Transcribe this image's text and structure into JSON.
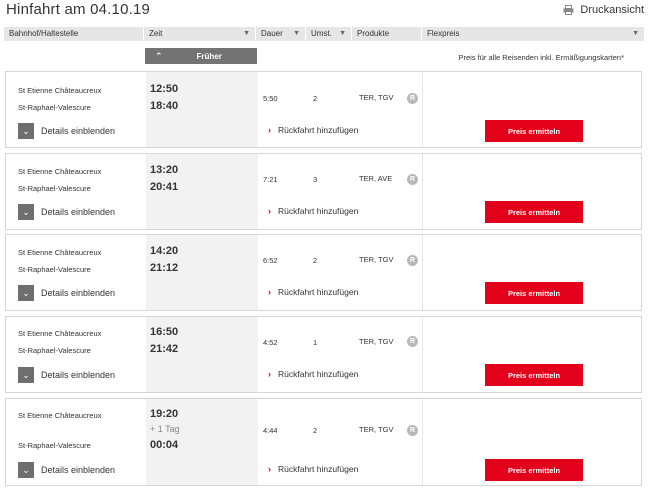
{
  "page": {
    "title": "Hinfahrt am 04.10.19",
    "print_label": "Druckansicht"
  },
  "columns": [
    {
      "label": "Bahnhof/Haltestelle",
      "sortable": false
    },
    {
      "label": "Zeit",
      "sortable": true
    },
    {
      "label": "Dauer",
      "sortable": true
    },
    {
      "label": "Umst.",
      "sortable": true
    },
    {
      "label": "Produkte",
      "sortable": false
    },
    {
      "label": "Flexpreis",
      "sortable": true
    }
  ],
  "earlier_label": "Früher",
  "price_note": "Preis für alle Reisenden inkl. Ermäßigungskarten*",
  "connections": [
    {
      "from": "St Etienne Châteaucreux",
      "to": "St-Raphael-Valescure",
      "dep": "12:50",
      "arr": "18:40",
      "extra": "",
      "duration": "5:50",
      "changes": "2",
      "products": "TER, TGV"
    },
    {
      "from": "St Etienne Châteaucreux",
      "to": "St-Raphael-Valescure",
      "dep": "13:20",
      "arr": "20:41",
      "extra": "",
      "duration": "7:21",
      "changes": "3",
      "products": "TER, AVE"
    },
    {
      "from": "St Etienne Châteaucreux",
      "to": "St-Raphael-Valescure",
      "dep": "14:20",
      "arr": "21:12",
      "extra": "",
      "duration": "6:52",
      "changes": "2",
      "products": "TER, TGV"
    },
    {
      "from": "St Etienne Châteaucreux",
      "to": "St-Raphael-Valescure",
      "dep": "16:50",
      "arr": "21:42",
      "extra": "",
      "duration": "4:52",
      "changes": "1",
      "products": "TER, TGV"
    },
    {
      "from": "St Etienne Châteaucreux",
      "to": "St-Raphael-Valescure",
      "dep": "19:20",
      "arr": "00:04",
      "extra": "+ 1 Tag",
      "duration": "4:44",
      "changes": "2",
      "products": "TER, TGV"
    }
  ],
  "labels": {
    "details": "Details einblenden",
    "return": "Rückfahrt hinzufügen",
    "price": "Preis ermitteln",
    "reservation_badge": "R"
  },
  "colors": {
    "accent_red": "#e2001a",
    "header_bg": "#e6e6e6",
    "dark_button": "#737373"
  }
}
